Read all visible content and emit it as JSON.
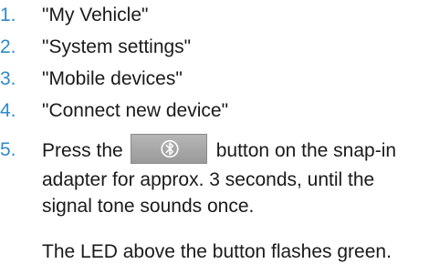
{
  "steps": [
    {
      "number": "1.",
      "text": "\"My Vehicle\""
    },
    {
      "number": "2.",
      "text": "\"System settings\""
    },
    {
      "number": "3.",
      "text": "\"Mobile devices\""
    },
    {
      "number": "4.",
      "text": "\"Connect new device\""
    },
    {
      "number": "5.",
      "text_before": "Press the",
      "text_after": "button on the snap-in",
      "line2": "adapter for approx. 3 seconds, until the",
      "line3": "signal tone sounds once.",
      "button_icon": "bluetooth-icon"
    }
  ],
  "note": "The LED above the button flashes green.",
  "colors": {
    "accent": "#2f8bc8",
    "text": "#1a1a1a",
    "button": "#a8a8a8"
  }
}
